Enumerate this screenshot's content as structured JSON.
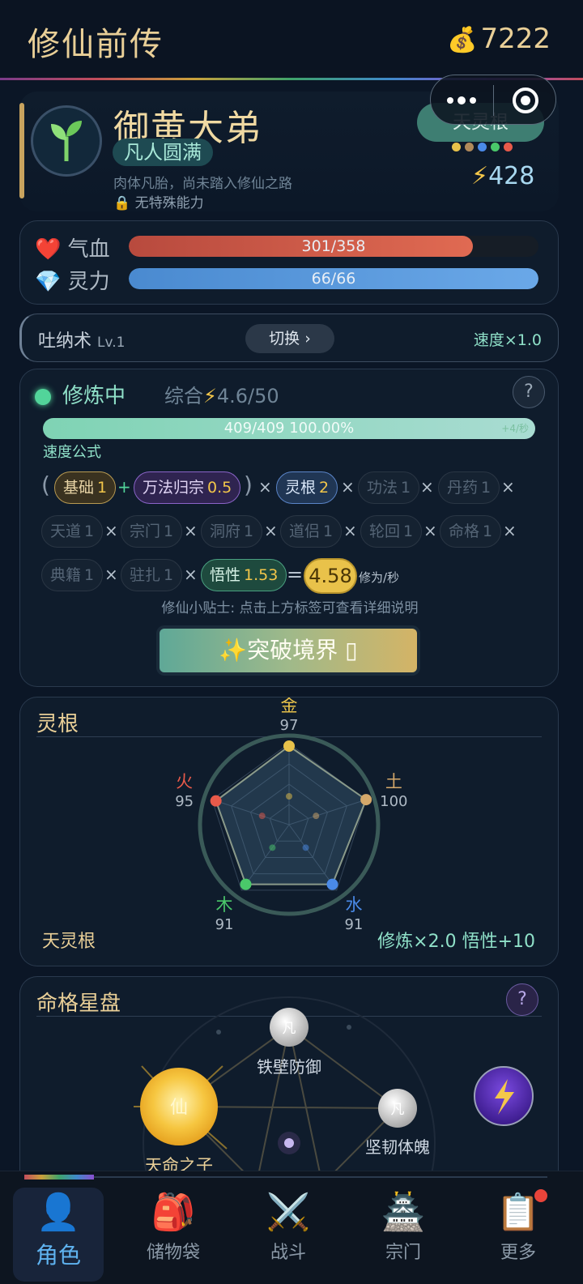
{
  "header": {
    "title": "修仙前传",
    "coin_icon": "money-bag-icon",
    "coins": "7222"
  },
  "profile": {
    "name": "御黄大弟",
    "realm": "凡人圆满",
    "description": "肉体凡胎，尚未踏入修仙之路",
    "ability": "无特殊能力",
    "root_button": "天灵根",
    "power_icon": "⚡",
    "power": "428",
    "dot_colors": [
      "#e8c24a",
      "#b08a5a",
      "#4a8ae8",
      "#4ac86a",
      "#e85a4a"
    ]
  },
  "stats": {
    "hp_label": "气血",
    "hp_value": "301/358",
    "hp_fraction": 0.8408,
    "mp_label": "灵力",
    "mp_value": "66/66",
    "mp_fraction": 1.0
  },
  "breathing": {
    "name": "吐纳术",
    "level": "Lv.1",
    "switch_label": "切换 ›",
    "speed": "速度×1.0"
  },
  "cultivation": {
    "status": "修炼中",
    "summary_label": "综合",
    "summary_icon": "⚡",
    "summary_value": "4.6/50",
    "help": "?",
    "progress_text": "409/409  100.00%",
    "progress_rate": "+4/秒",
    "progress_fraction": 1.0,
    "formula_label": "速度公式",
    "chips": [
      {
        "label": "基础",
        "value": "1"
      },
      {
        "label": "万法归宗",
        "value": "0.5"
      },
      {
        "label": "灵根",
        "value": "2"
      },
      {
        "label": "功法",
        "value": "1"
      },
      {
        "label": "丹药",
        "value": "1"
      },
      {
        "label": "天道",
        "value": "1"
      },
      {
        "label": "宗门",
        "value": "1"
      },
      {
        "label": "洞府",
        "value": "1"
      },
      {
        "label": "道侣",
        "value": "1"
      },
      {
        "label": "轮回",
        "value": "1"
      },
      {
        "label": "命格",
        "value": "1"
      },
      {
        "label": "典籍",
        "value": "1"
      },
      {
        "label": "驻扎",
        "value": "1"
      },
      {
        "label": "悟性",
        "value": "1.53"
      }
    ],
    "ops": {
      "open": "(",
      "close": ")",
      "plus": "+",
      "times": "×",
      "equals": "="
    },
    "result": "4.58",
    "result_unit": "修为/秒",
    "tip": "修仙小贴士: 点击上方标签可查看详细说明",
    "breakthrough": "✨突破境界 ▯"
  },
  "spirit_root": {
    "title": "灵根",
    "elements": [
      {
        "name": "金",
        "value": 97,
        "color": "#e8c24a"
      },
      {
        "name": "土",
        "value": 100,
        "color": "#d4a86a"
      },
      {
        "name": "水",
        "value": 91,
        "color": "#4a8ae8"
      },
      {
        "name": "木",
        "value": 91,
        "color": "#4ac86a"
      },
      {
        "name": "火",
        "value": 95,
        "color": "#e85a4a"
      }
    ],
    "root_name": "天灵根",
    "bonus": "修炼×2.0  悟性+10"
  },
  "star_chart": {
    "title": "命格星盘",
    "help": "?",
    "nodes": [
      {
        "badge": "凡",
        "label": "铁壁防御"
      },
      {
        "badge": "凡",
        "label": "坚韧体魄"
      },
      {
        "badge": "仙",
        "label": "天命之子"
      }
    ]
  },
  "tabs": [
    {
      "icon": "👤",
      "label": "角色"
    },
    {
      "icon": "🎒",
      "label": "储物袋"
    },
    {
      "icon": "⚔️",
      "label": "战斗"
    },
    {
      "icon": "🏯",
      "label": "宗门"
    },
    {
      "icon": "📋",
      "label": "更多"
    }
  ]
}
